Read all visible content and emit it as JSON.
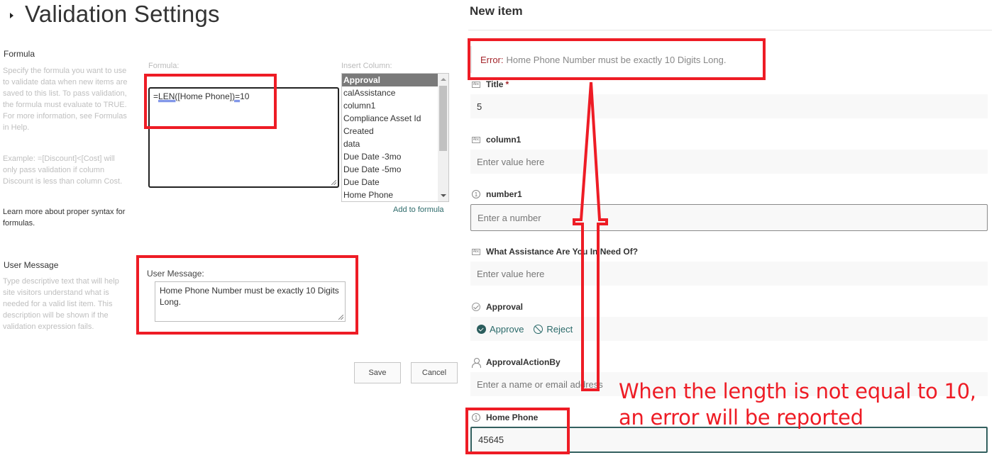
{
  "left": {
    "page_title": "Validation Settings",
    "formula_section": {
      "title": "Formula",
      "description": "Specify the formula you want to use to validate data when new items are saved to this list. To pass validation, the formula must evaluate to TRUE. For more information, see Formulas in Help.",
      "example": "Example: =[Discount]<[Cost] will only pass validation if column Discount is less than column Cost.",
      "learn_more_link": "Learn more about proper syntax for formulas.",
      "formula_label": "Formula:",
      "formula_parts": {
        "eq": "=",
        "fn": "LEN(",
        "arg": "[Home Phone]",
        "close": ")",
        "op": "=",
        "val": "10"
      },
      "insert_column_label": "Insert Column:",
      "columns": [
        "Approval",
        "calAssistance",
        "column1",
        "Compliance Asset Id",
        "Created",
        "data",
        "Due Date -3mo",
        "Due Date -5mo",
        "Due Date",
        "Home Phone"
      ],
      "selected_column": "Approval",
      "add_to_formula": "Add to formula"
    },
    "user_message_section": {
      "title": "User Message",
      "description": "Type descriptive text that will help site visitors understand what is needed for a valid list item. This description will be shown if the validation expression fails.",
      "field_label": "User Message:",
      "value": "Home Phone Number must be exactly 10 Digits Long."
    },
    "buttons": {
      "save": "Save",
      "cancel": "Cancel"
    }
  },
  "right": {
    "panel_title": "New item",
    "error": {
      "label": "Error:",
      "message": "Home Phone Number must be exactly 10 Digits Long."
    },
    "fields": [
      {
        "label": "Title",
        "required_mark": "*",
        "icon": "text-field-icon",
        "value": "5"
      },
      {
        "label": "column1",
        "icon": "text-field-icon",
        "placeholder": "Enter value here"
      },
      {
        "label": "number1",
        "icon": "number-field-icon",
        "placeholder": "Enter a number"
      },
      {
        "label": "What Assistance Are You In Need Of?",
        "icon": "text-field-icon",
        "placeholder": "Enter value here"
      },
      {
        "label": "Approval",
        "icon": "check-circle-icon",
        "options": [
          "Approve",
          "Reject"
        ]
      },
      {
        "label": "ApprovalActionBy",
        "icon": "person-icon",
        "placeholder": "Enter a name or email address"
      },
      {
        "label": "Home Phone",
        "icon": "number-field-icon",
        "value": "45645"
      }
    ],
    "icon_glyphs": {
      "text": "Abc",
      "number": "1"
    }
  },
  "annotation": {
    "text_line1": "When the length is not equal to 10,",
    "text_line2": "an error will be reported",
    "color": "#ee1c25"
  }
}
